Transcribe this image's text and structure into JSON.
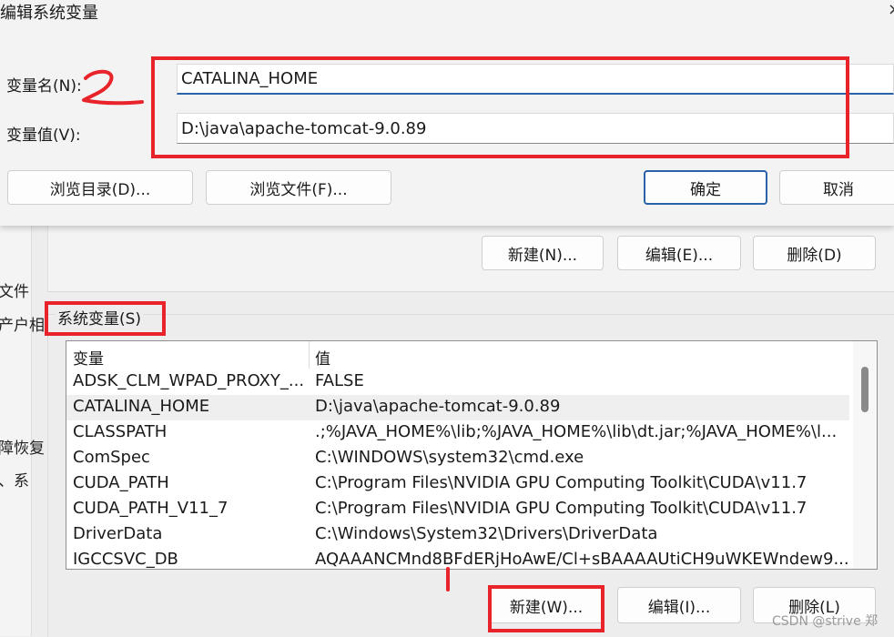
{
  "dialog": {
    "title": "编辑系统变量",
    "close_glyph": "×",
    "name_label": "变量名(N):",
    "value_label": "变量值(V):",
    "name_value": "CATALINA_HOME",
    "value_value": "D:\\java\\apache-tomcat-9.0.89",
    "browse_dir": "浏览目录(D)...",
    "browse_file": "浏览文件(F)...",
    "ok": "确定",
    "cancel": "取消"
  },
  "background": {
    "left_texts": [
      "文件",
      "产户相",
      "障恢复",
      "、系"
    ],
    "user_buttons": {
      "new": "新建(N)...",
      "edit": "编辑(E)...",
      "delete": "删除(D)"
    },
    "sys_title": "系统变量(S)",
    "columns": [
      "变量",
      "值"
    ],
    "rows": [
      {
        "name": "ADSK_CLM_WPAD_PROXY_...",
        "value": "FALSE"
      },
      {
        "name": "CATALINA_HOME",
        "value": "D:\\java\\apache-tomcat-9.0.89"
      },
      {
        "name": "CLASSPATH",
        "value": ".;%JAVA_HOME%\\lib;%JAVA_HOME%\\lib\\dt.jar;%JAVA_HOME%\\l..."
      },
      {
        "name": "ComSpec",
        "value": "C:\\WINDOWS\\system32\\cmd.exe"
      },
      {
        "name": "CUDA_PATH",
        "value": "C:\\Program Files\\NVIDIA GPU Computing Toolkit\\CUDA\\v11.7"
      },
      {
        "name": "CUDA_PATH_V11_7",
        "value": "C:\\Program Files\\NVIDIA GPU Computing Toolkit\\CUDA\\v11.7"
      },
      {
        "name": "DriverData",
        "value": "C:\\Windows\\System32\\Drivers\\DriverData"
      },
      {
        "name": "IGCCSVC_DB",
        "value": "AQAAANCMnd8BFdERjHoAwE/Cl+sBAAAAUtiCH9uWKEWndew9..."
      }
    ],
    "sys_buttons": {
      "new": "新建(W)...",
      "edit": "编辑(I)...",
      "delete": "删除(L)"
    }
  },
  "annotations": {
    "number_two": "2",
    "number_one": "1",
    "color": "#e8242a"
  },
  "watermark": "CSDN @strive 郑"
}
